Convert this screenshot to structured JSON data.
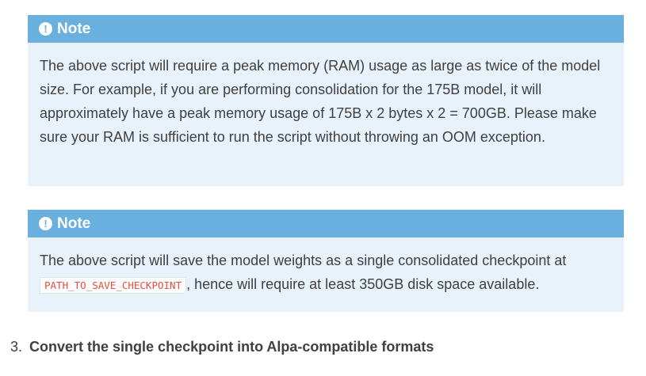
{
  "notes": [
    {
      "title": "Note",
      "icon": "exclamation-circle-icon",
      "body": "The above script will require a peak memory (RAM) usage as large as twice of the model size. For example, if you are performing consolidation for the 175B model, it will approximately have a peak memory usage of 175B x 2 bytes x 2 = 700GB. Please make sure your RAM is sufficient to run the script without throwing an OOM exception."
    },
    {
      "title": "Note",
      "icon": "exclamation-circle-icon",
      "body_before": "The above script will save the model weights as a single consolidated checkpoint at ",
      "code": "PATH_TO_SAVE_CHECKPOINT",
      "body_after": ", hence will require at least 350GB disk space available."
    }
  ],
  "step": {
    "number": "3.",
    "title": "Convert the single checkpoint into Alpa-compatible formats"
  },
  "colors": {
    "note_header": "#6ab0de",
    "note_background": "#e7f2fa",
    "text": "#404040",
    "code_text": "#e74c3c"
  }
}
